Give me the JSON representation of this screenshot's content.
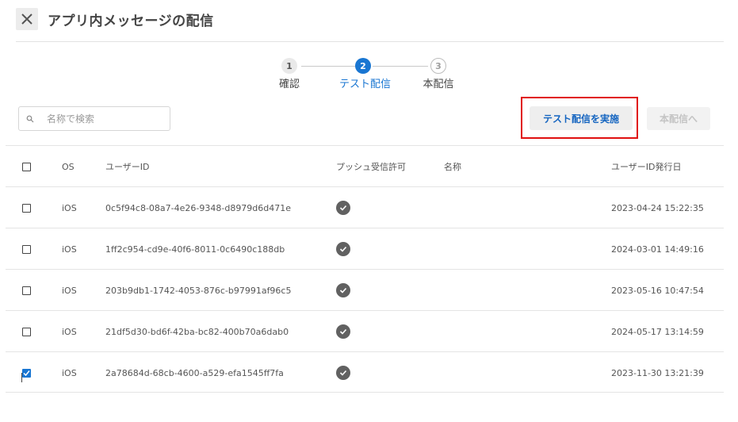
{
  "header": {
    "title": "アプリ内メッセージの配信",
    "close_icon": "close-icon"
  },
  "stepper": {
    "steps": [
      {
        "number": "1",
        "label": "確認",
        "state": "done"
      },
      {
        "number": "2",
        "label": "テスト配信",
        "state": "active"
      },
      {
        "number": "3",
        "label": "本配信",
        "state": "todo"
      }
    ]
  },
  "search": {
    "placeholder": "名称で検索",
    "value": ""
  },
  "actions": {
    "test_label": "テスト配信を実施",
    "release_label": "本配信へ"
  },
  "table": {
    "columns": [
      "OS",
      "ユーザーID",
      "プッシュ受信許可",
      "名称",
      "ユーザーID発行日"
    ],
    "rows": [
      {
        "checked": false,
        "os": "iOS",
        "user_id": "0c5f94c8-08a7-4e26-9348-d8979d6d471e",
        "push": true,
        "name": "",
        "issued": "2023-04-24 15:22:35"
      },
      {
        "checked": false,
        "os": "iOS",
        "user_id": "1ff2c954-cd9e-40f6-8011-0c6490c188db",
        "push": true,
        "name": "",
        "issued": "2024-03-01 14:49:16"
      },
      {
        "checked": false,
        "os": "iOS",
        "user_id": "203b9db1-1742-4053-876c-b97991af96c5",
        "push": true,
        "name": "",
        "issued": "2023-05-16 10:47:54"
      },
      {
        "checked": false,
        "os": "iOS",
        "user_id": "21df5d30-bd6f-42ba-bc82-400b70a6dab0",
        "push": true,
        "name": "",
        "issued": "2024-05-17 13:14:59"
      },
      {
        "checked": true,
        "os": "iOS",
        "user_id": "2a78684d-68cb-4600-a529-efa1545ff7fa",
        "push": true,
        "name": "",
        "issued": "2023-11-30 13:21:39"
      }
    ]
  },
  "colors": {
    "accent": "#1976d2",
    "highlight": "#e01010"
  }
}
